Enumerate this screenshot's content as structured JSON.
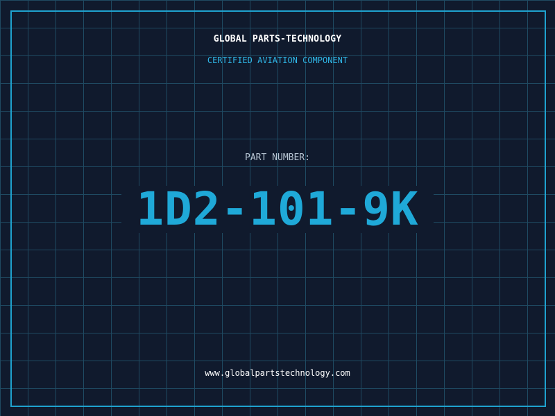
{
  "header": {
    "company": "GLOBAL PARTS-TECHNOLOGY",
    "subtitle": "CERTIFIED AVIATION COMPONENT"
  },
  "part": {
    "label": "PART NUMBER:",
    "number": "1D2-101-9K"
  },
  "footer": {
    "url": "www.globalpartstechnology.com"
  },
  "colors": {
    "background": "#101a2d",
    "grid": "#1f4a62",
    "accent": "#1fa9d8",
    "border": "#1fa2cf"
  }
}
